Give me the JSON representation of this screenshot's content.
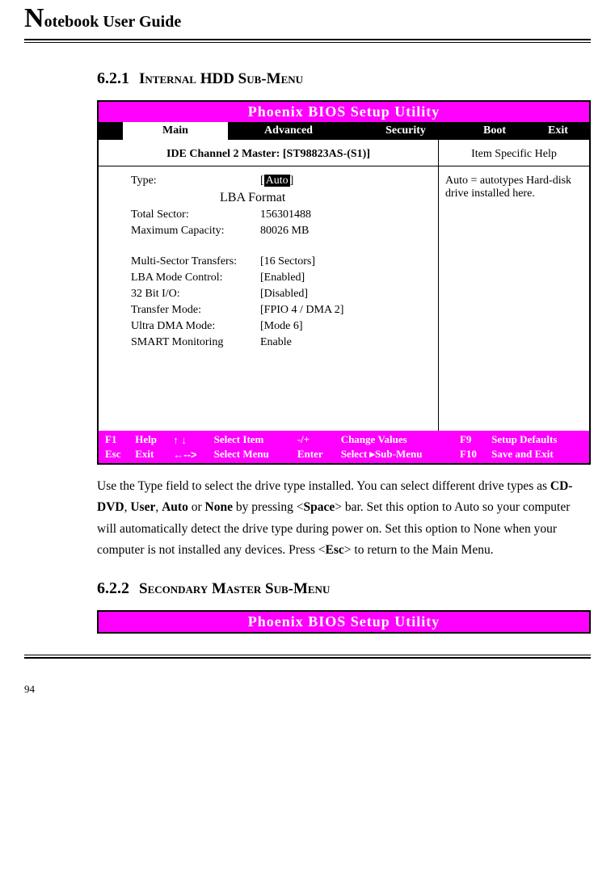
{
  "header": {
    "dropcap": "N",
    "rest": "otebook User Guide"
  },
  "section1": {
    "num": "6.2.1",
    "title": "Internal HDD Sub-Menu"
  },
  "bios": {
    "title": "Phoenix BIOS Setup Utility",
    "tabs": {
      "main": "Main",
      "advanced": "Advanced",
      "security": "Security",
      "boot": "Boot",
      "exit": "Exit"
    },
    "ide_header": "IDE Channel 2 Master: [ST98823AS-(S1)]",
    "help_header": "Item Specific Help",
    "help_text": "Auto = autotypes Hard-disk drive installed here.",
    "fields": {
      "type_label": "Type:",
      "type_value": "Auto",
      "lba": "LBA Format",
      "total_sector_label": "Total Sector:",
      "total_sector_value": "156301488",
      "max_cap_label": "Maximum Capacity:",
      "max_cap_value": "80026 MB",
      "mst_label": "Multi-Sector Transfers:",
      "mst_value": "[16 Sectors]",
      "lba_mode_label": "LBA Mode Control:",
      "lba_mode_value": "[Enabled]",
      "bit32_label": "32 Bit I/O:",
      "bit32_value": "[Disabled]",
      "transfer_label": "Transfer Mode:",
      "transfer_value": "[FPIO 4 / DMA 2]",
      "ultra_label": "Ultra DMA Mode:",
      "ultra_value": "[Mode 6]",
      "smart_label": "SMART Monitoring",
      "smart_value": "Enable"
    },
    "footer": {
      "f1": "F1",
      "help": "Help",
      "arrows_ud": "↑ ↓",
      "select_item": "Select Item",
      "pm": "-/+",
      "change_values": "Change Values",
      "f9": "F9",
      "setup_defaults": "Setup Defaults",
      "esc": "Esc",
      "exit": "Exit",
      "arrows_lr": "←-->",
      "select_menu": "Select Menu",
      "enter": "Enter",
      "select_sub": "Select  ▸Sub-Menu",
      "f10": "F10",
      "save_exit": "Save and Exit"
    }
  },
  "body_text_parts": {
    "p1": "Use the Type field to select the drive type installed. You can select different drive types as ",
    "b1": "CD-DVD",
    "c1": ", ",
    "b2": "User",
    "c2": ", ",
    "b3": "Auto",
    "c3": " or ",
    "b4": "None",
    "c4": " by pressing <",
    "b5": "Space",
    "c5": "> bar. Set this option to Auto so your computer will automatically detect the drive type during power on. Set this option to None when your computer is not installed any devices. Press <",
    "b6": "Esc",
    "c6": "> to return to the Main Menu."
  },
  "section2": {
    "num": "6.2.2",
    "title": "Secondary Master Sub-Menu"
  },
  "bios2_title": "Phoenix BIOS Setup Utility",
  "page_num": "94"
}
